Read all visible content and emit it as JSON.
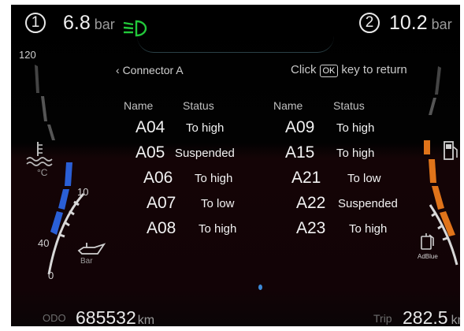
{
  "header": {
    "pressure1": {
      "number": "1",
      "value": "6.8",
      "unit": "bar"
    },
    "pressure2": {
      "number": "2",
      "value": "10.2",
      "unit": "bar"
    },
    "headlight_color": "#22c83a"
  },
  "nav": {
    "back_label": "Connector A",
    "return_prefix": "Click",
    "return_key": "OK",
    "return_suffix": "key to return"
  },
  "table": {
    "columns": {
      "name": "Name",
      "status": "Status"
    },
    "left": [
      {
        "code": "A04",
        "status": "To high"
      },
      {
        "code": "A05",
        "status": "Suspended"
      },
      {
        "code": "A06",
        "status": "To high"
      },
      {
        "code": "A07",
        "status": "To low"
      },
      {
        "code": "A08",
        "status": "To high"
      }
    ],
    "right": [
      {
        "code": "A09",
        "status": "To high"
      },
      {
        "code": "A15",
        "status": "To high"
      },
      {
        "code": "A21",
        "status": "To low"
      },
      {
        "code": "A22",
        "status": "Suspended"
      },
      {
        "code": "A23",
        "status": "To high"
      }
    ]
  },
  "left_gauges": {
    "tick_120": "120",
    "tick_10": "10",
    "tick_40": "40",
    "tick_0": "0",
    "temp_unit": "°C",
    "oil_unit": "Bar",
    "bar_color": "#2a5fd6"
  },
  "right_gauges": {
    "adblue_label": "AdBlue",
    "bar_color": "#e0741a"
  },
  "footer": {
    "odo_label": "ODO",
    "odo_value": "685532",
    "odo_unit": "km",
    "trip_label": "Trip",
    "trip_value": "282.5",
    "trip_unit": "km"
  }
}
